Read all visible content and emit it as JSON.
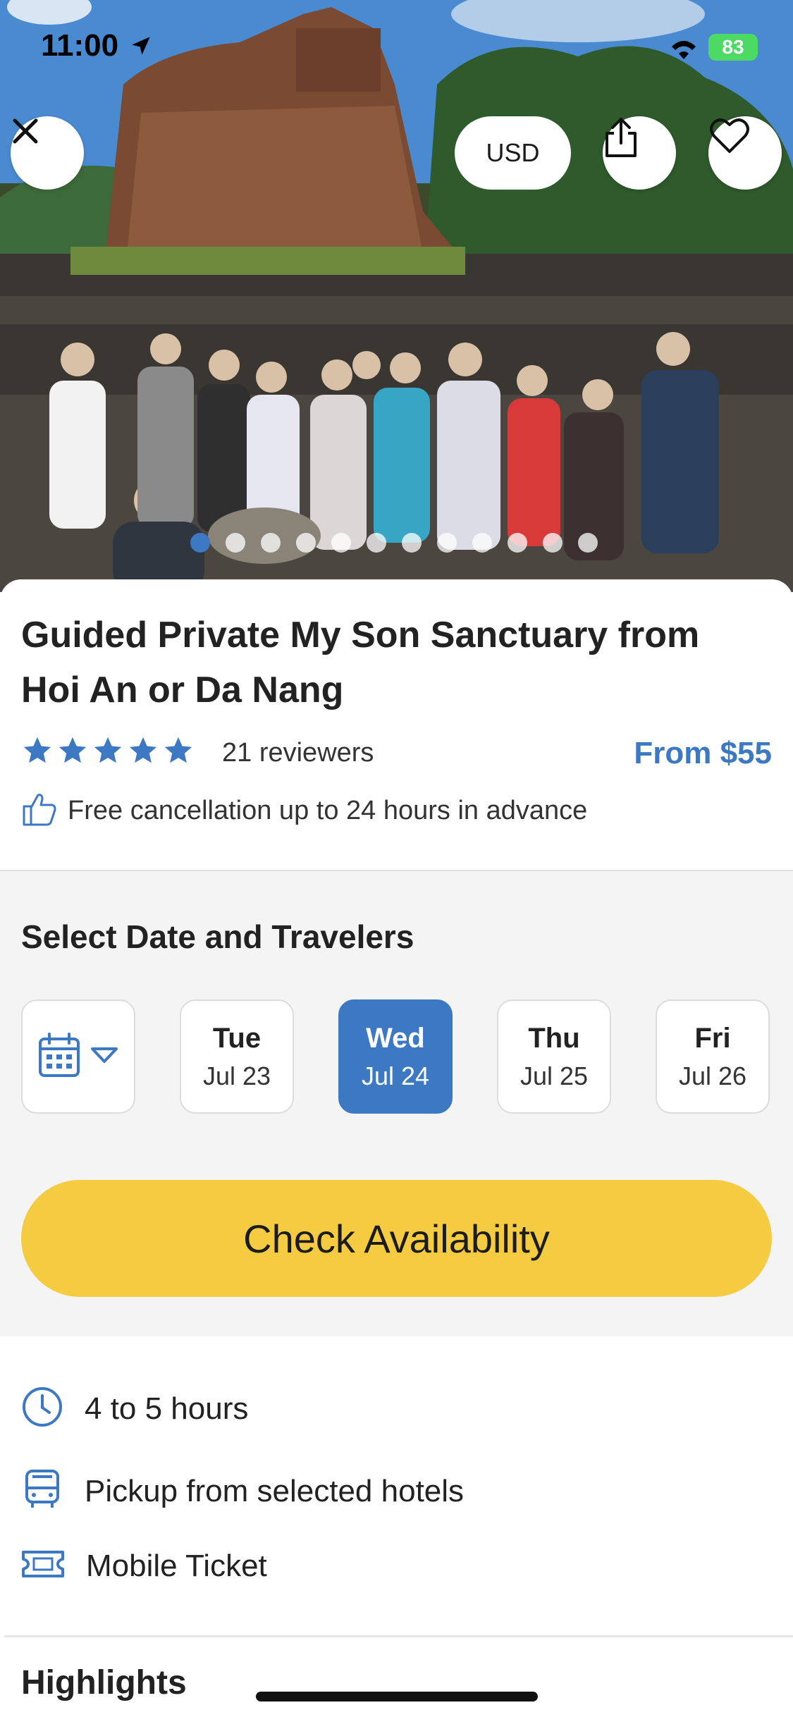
{
  "status_bar": {
    "time": "11:00",
    "battery": "83"
  },
  "header": {
    "currency": "USD"
  },
  "gallery": {
    "total": 12,
    "active_index": 0
  },
  "tour": {
    "title": "Guided Private My Son Sanctuary from Hoi An or Da Nang",
    "rating_stars": 5,
    "reviews": "21 reviewers",
    "price": "From $55",
    "cancellation": "Free cancellation up to 24 hours in advance"
  },
  "booking": {
    "section_title": "Select Date and Travelers",
    "dates": [
      {
        "dow": "Tue",
        "md": "Jul 23",
        "selected": false
      },
      {
        "dow": "Wed",
        "md": "Jul 24",
        "selected": true
      },
      {
        "dow": "Thu",
        "md": "Jul 25",
        "selected": false
      },
      {
        "dow": "Fri",
        "md": "Jul 26",
        "selected": false
      }
    ],
    "cta": "Check Availability"
  },
  "features": [
    {
      "icon": "clock-icon",
      "text": "4 to 5 hours"
    },
    {
      "icon": "bus-icon",
      "text": "Pickup from selected hotels"
    },
    {
      "icon": "ticket-icon",
      "text": "Mobile Ticket"
    }
  ],
  "highlights_title": "Highlights",
  "colors": {
    "accent": "#3d78c2",
    "cta": "#f5cb42"
  }
}
